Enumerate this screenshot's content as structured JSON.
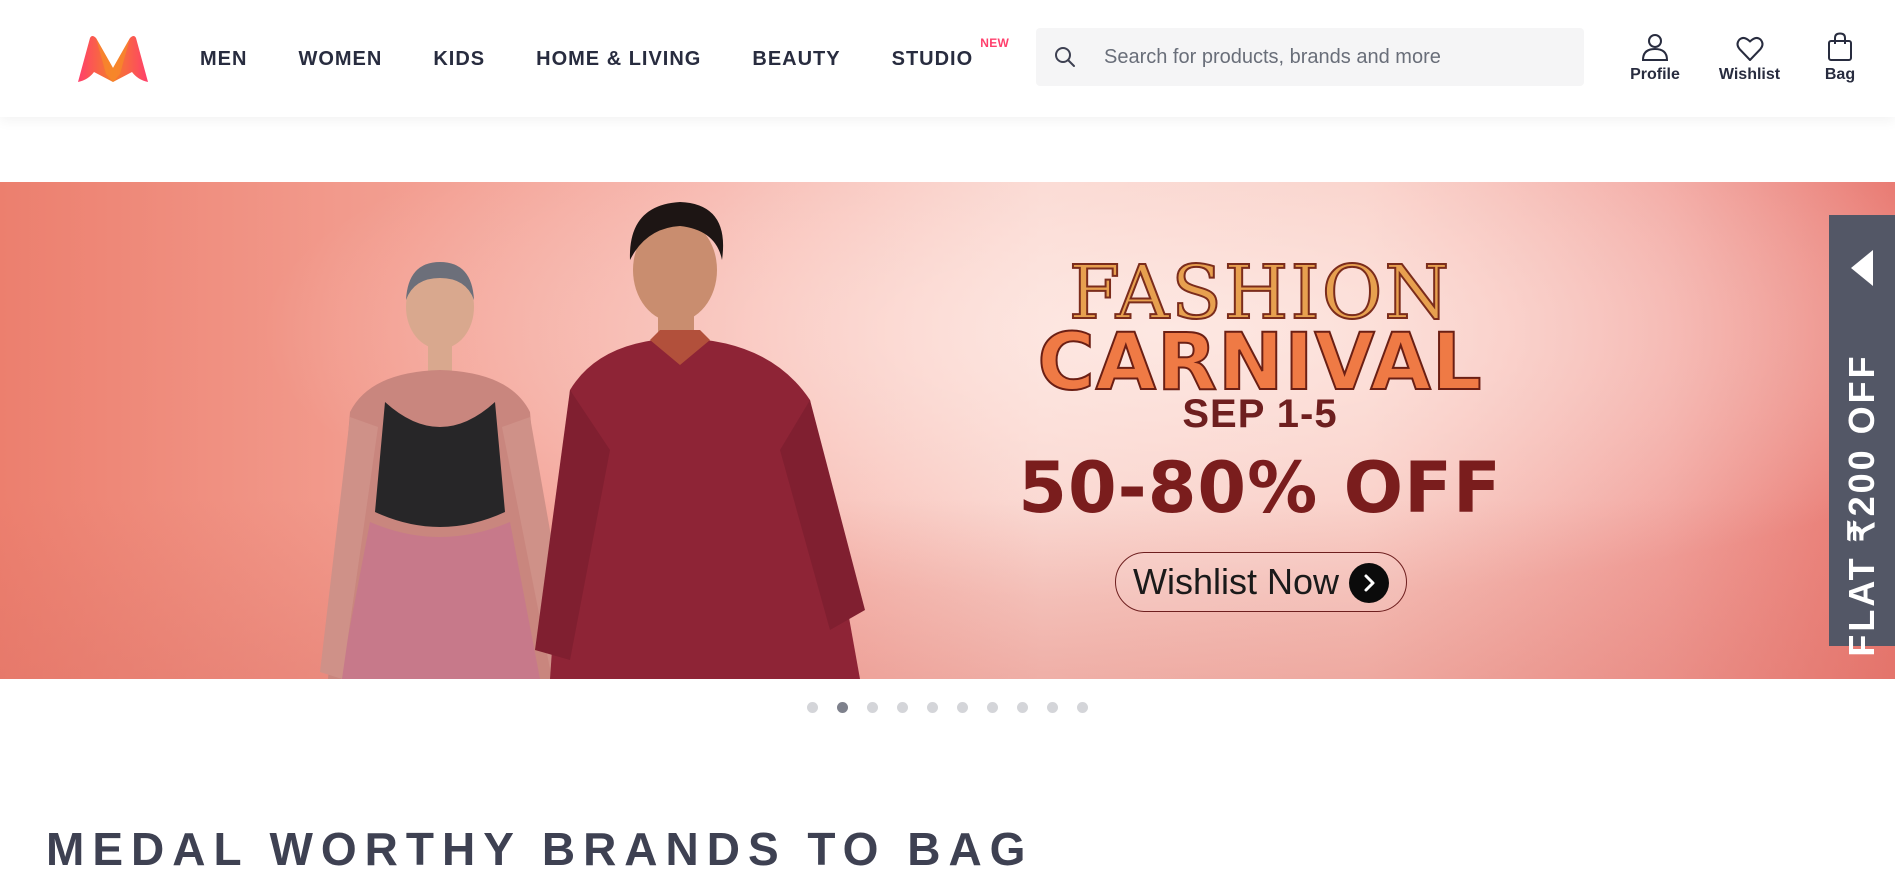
{
  "brand": {
    "logo_icon": "myntra-logo",
    "colors": {
      "accent": "#ff3f6c",
      "logo_pink": "#ff3f6c",
      "logo_orange": "#f47e2a",
      "side_tab": "#535766"
    }
  },
  "nav": {
    "items": [
      {
        "label": "MEN"
      },
      {
        "label": "WOMEN"
      },
      {
        "label": "KIDS"
      },
      {
        "label": "HOME & LIVING"
      },
      {
        "label": "BEAUTY"
      },
      {
        "label": "STUDIO",
        "badge": "NEW"
      }
    ]
  },
  "search": {
    "icon": "search-icon",
    "placeholder": "Search for products, brands and more",
    "value": ""
  },
  "actions": {
    "profile": {
      "label": "Profile",
      "icon": "profile-icon"
    },
    "wishlist": {
      "label": "Wishlist",
      "icon": "heart-icon"
    },
    "bag": {
      "label": "Bag",
      "icon": "bag-icon"
    }
  },
  "banner": {
    "line1": "FASHION",
    "line2": "CARNIVAL",
    "dates": "SEP 1-5",
    "offer": "50-80% OFF",
    "cta": "Wishlist Now",
    "cta_icon": "chevron-right-icon"
  },
  "side_tab": {
    "text": "FLAT ₹200 OFF",
    "icon": "caret-left-icon"
  },
  "carousel": {
    "total_slides": 10,
    "active_index": 1
  },
  "section": {
    "title": "MEDAL WORTHY BRANDS TO BAG"
  }
}
